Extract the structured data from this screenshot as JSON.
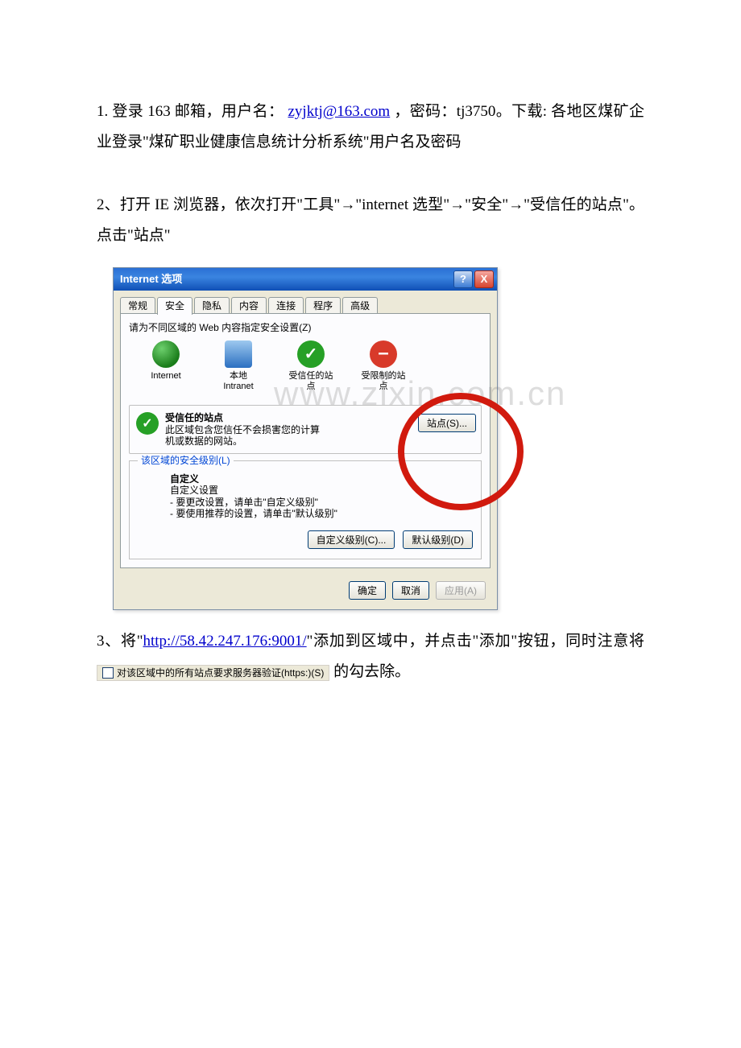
{
  "step1": {
    "prefix": "1.  登录 163 邮箱，用户名：",
    "email": "zyjktj@163.com",
    "mid": "，密码：tj3750。下载: 各地区煤矿企业登录\"煤矿职业健康信息统计分析系统\"用户名及密码"
  },
  "step2": {
    "text": "2、打开 IE 浏览器，依次打开\"工具\"→\"internet 选型\"→\"安全\"→\"受信任的站点\"。点击\"站点\""
  },
  "dialog": {
    "title": "Internet 选项",
    "help": "?",
    "close": "X",
    "tabs": [
      "常规",
      "安全",
      "隐私",
      "内容",
      "连接",
      "程序",
      "高级"
    ],
    "activeTabIndex": 1,
    "zoneLabel": "请为不同区域的 Web 内容指定安全设置(Z)",
    "zones": [
      {
        "name": "Internet"
      },
      {
        "name": "本地\nIntranet"
      },
      {
        "name": "受信任的站\n点"
      },
      {
        "name": "受限制的站\n点"
      }
    ],
    "trusted": {
      "title": "受信任的站点",
      "desc": "此区域包含您信任不会损害您的计算机或数据的网站。",
      "sitesBtn": "站点(S)..."
    },
    "levelGroup": {
      "legend": "该区域的安全级别(L)",
      "customTitle": "自定义",
      "customDesc": "自定义设置\n- 要更改设置，请单击\"自定义级别\"\n- 要使用推荐的设置，请单击\"默认级别\"",
      "customBtn": "自定义级别(C)...",
      "defaultBtn": "默认级别(D)"
    },
    "footer": {
      "ok": "确定",
      "cancel": "取消",
      "apply": "应用(A)"
    }
  },
  "watermark": "www.zixin.com.cn",
  "step3": {
    "prefix": "3、将\"",
    "url": "http://58.42.247.176:9001/",
    "mid": "\"添加到区域中，并点击\"添加\"按钮，同时注意将",
    "checkboxLabel": "对该区域中的所有站点要求服务器验证(https:)(S)",
    "suffix": "的勾去除。"
  }
}
